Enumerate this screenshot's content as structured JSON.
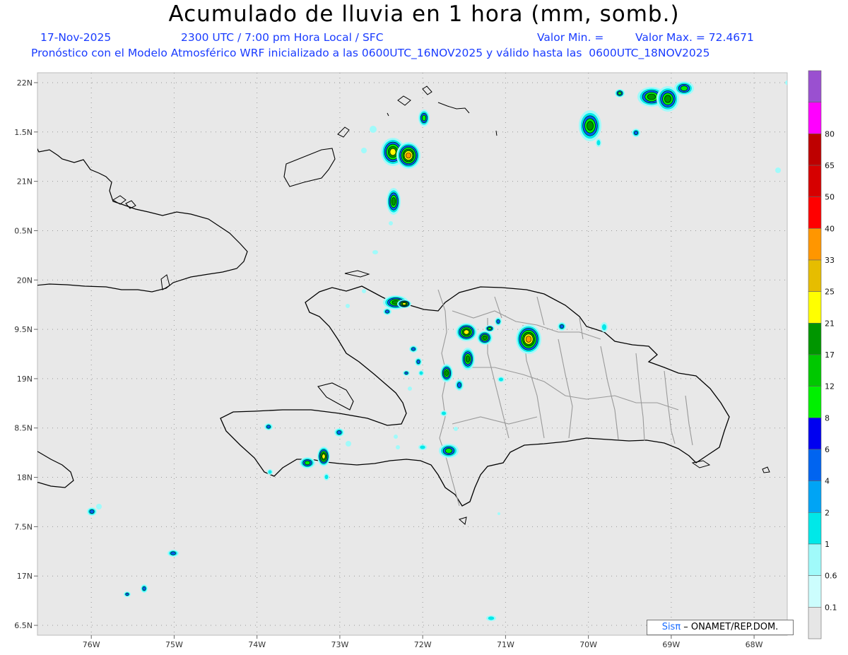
{
  "title": "Acumulado de lluvia en 1 hora (mm, somb.)",
  "header": {
    "date": "17-Nov-2025",
    "time": "2300 UTC / 7:00 pm Hora Local / SFC",
    "valor_min": "Valor Min. =",
    "valor_max": "Valor Max. = 72.4671",
    "model_line": "Pronóstico con el Modelo Atmosférico WRF inicializado a las 0600UTC_16NOV2025 y válido hasta las  0600UTC_18NOV2025"
  },
  "map": {
    "lat_labels": [
      "22N",
      "1.5N",
      "21N",
      "0.5N",
      "20N",
      "9.5N",
      "19N",
      "8.5N",
      "18N",
      "7.5N",
      "17N",
      "6.5N"
    ],
    "lon_labels": [
      "76W",
      "75W",
      "74W",
      "73W",
      "72W",
      "71W",
      "70W",
      "69W",
      "68W"
    ],
    "lat_range": [
      16.4,
      22.1
    ],
    "lon_range": [
      -76.65,
      -67.6
    ],
    "background_color": "#e8e8e8",
    "grid": "dotted"
  },
  "colorbar": {
    "labels": [
      "0.1",
      "0.6",
      "1",
      "2",
      "4",
      "6",
      "8",
      "12",
      "17",
      "21",
      "25",
      "33",
      "40",
      "50",
      "65",
      "80"
    ],
    "colors": [
      "#e6e6e6",
      "#ccfdfd",
      "#a0fafa",
      "#00e8e8",
      "#00a4f5",
      "#0064f0",
      "#0000f0",
      "#00f000",
      "#00c800",
      "#009600",
      "#ffff00",
      "#e6bd00",
      "#ff9600",
      "#ff0000",
      "#d60000",
      "#be0000",
      "#ff00ff",
      "#9a50d0"
    ]
  },
  "credit": {
    "sis": "Sisπ",
    "rest": " – ONAMET/REP.DOM."
  }
}
